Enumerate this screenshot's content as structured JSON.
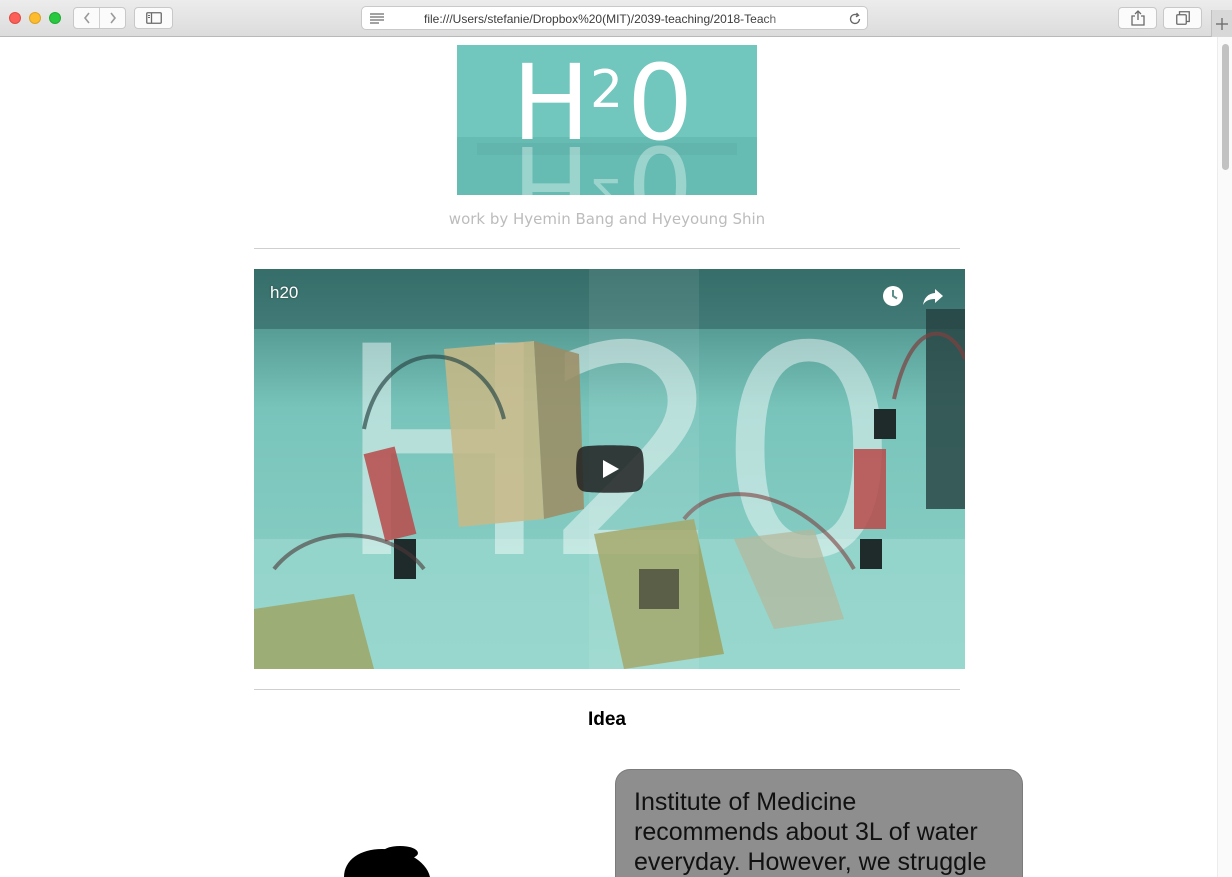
{
  "browser": {
    "url": "file:///Users/stefanie/Dropbox%20(MIT)/2039-teaching/2018-Teach"
  },
  "logo": {
    "text": "H",
    "superscript": "2",
    "tail": "0",
    "bg_color": "#71c6bd"
  },
  "byline": "work by Hyemin Bang and Hyeyoung Shin",
  "video": {
    "title": "h20",
    "overlay_text": "H20",
    "play_color": "#212121"
  },
  "idea": {
    "heading": "Idea",
    "bubble_lines": [
      "Institute of Medicine",
      "recommends about 3L of water",
      "everyday. However, we struggle"
    ]
  },
  "icons": {
    "reader": "reader-icon",
    "reload": "reload-icon",
    "share": "share-icon",
    "tabs": "tabs-icon",
    "back": "chevron-left-icon",
    "forward": "chevron-right-icon",
    "sidebar": "sidebar-icon",
    "new_tab": "plus-icon",
    "watch_later": "clock-icon",
    "video_share": "share-arrow-icon",
    "play": "play-icon"
  }
}
